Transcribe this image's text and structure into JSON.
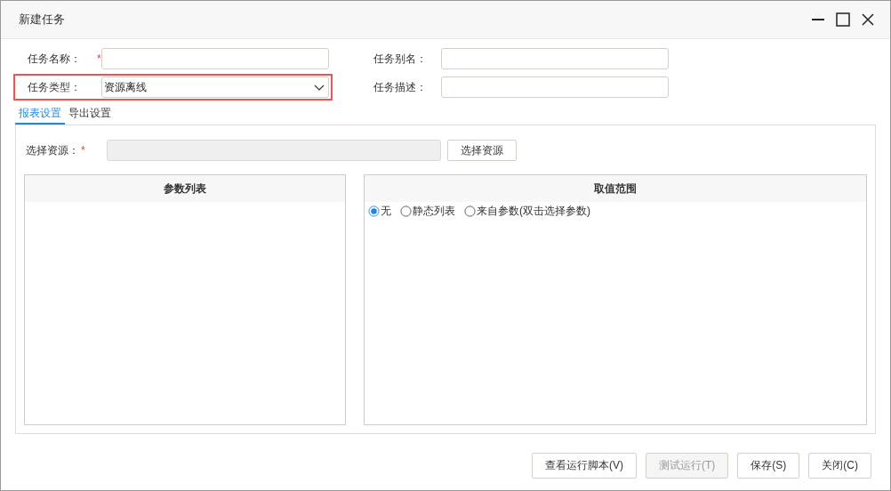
{
  "window": {
    "title": "新建任务"
  },
  "form_left": [
    {
      "label": "任务名称：",
      "required_mark": "*",
      "kind": "text",
      "highlighted": false
    },
    {
      "label": "任务类型：",
      "kind": "select",
      "value": "资源离线",
      "highlighted": true
    }
  ],
  "form_right": [
    {
      "label": "任务别名：",
      "kind": "text",
      "highlighted": false
    },
    {
      "label": "任务描述：",
      "kind": "text",
      "highlighted": false
    }
  ],
  "tabs": [
    {
      "label": "报表设置",
      "selected": true
    },
    {
      "label": "导出设置",
      "selected": false
    }
  ],
  "resource": {
    "label": "选择资源：",
    "required_mark": "*",
    "disabled": true,
    "button": "选择资源"
  },
  "param_list": {
    "header": "参数列表"
  },
  "value_range": {
    "header": "取值范围",
    "options": [
      {
        "label": "无",
        "selected": true
      },
      {
        "label": "静态列表",
        "selected": false
      },
      {
        "label": "来自参数(双击选择参数)",
        "selected": false
      }
    ]
  },
  "buttons": [
    {
      "label": "查看运行脚本(V)",
      "disabled": false
    },
    {
      "label": "测试运行(T)",
      "disabled": true
    },
    {
      "label": "保存(S)",
      "disabled": false
    },
    {
      "label": "关闭(C)",
      "disabled": false
    }
  ]
}
